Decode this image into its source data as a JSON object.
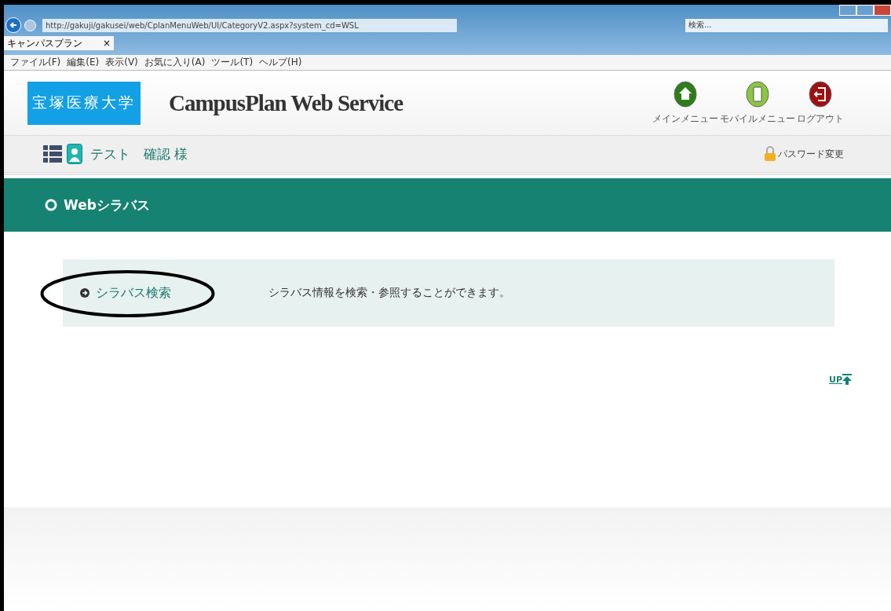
{
  "browser": {
    "url": "http://gakuji/gakusei/web/CplanMenuWeb/UI/CategoryV2.aspx?system_cd=WSL",
    "search_placeholder": "検索...",
    "tab_title": "キャンパスプラン",
    "tab_close": "×",
    "menu": [
      "ファイル(F)",
      "編集(E)",
      "表示(V)",
      "お気に入り(A)",
      "ツール(T)",
      "ヘルプ(H)"
    ]
  },
  "header": {
    "logo": "宝塚医療大学",
    "title": "CampusPlan Web Service",
    "nav": [
      {
        "kind": "home",
        "label": "メインメニュー"
      },
      {
        "kind": "mobile",
        "label": "モバイルメニュー"
      },
      {
        "kind": "logout",
        "label": "ログアウト"
      }
    ]
  },
  "user_bar": {
    "user": "テスト　確認 様",
    "password_link": "パスワード変更"
  },
  "section": {
    "title": "Webシラバス"
  },
  "items": [
    {
      "label": "シラバス検索",
      "description": "シラバス情報を検索・参照することができます。",
      "highlighted": true
    }
  ],
  "up_link": "UP"
}
